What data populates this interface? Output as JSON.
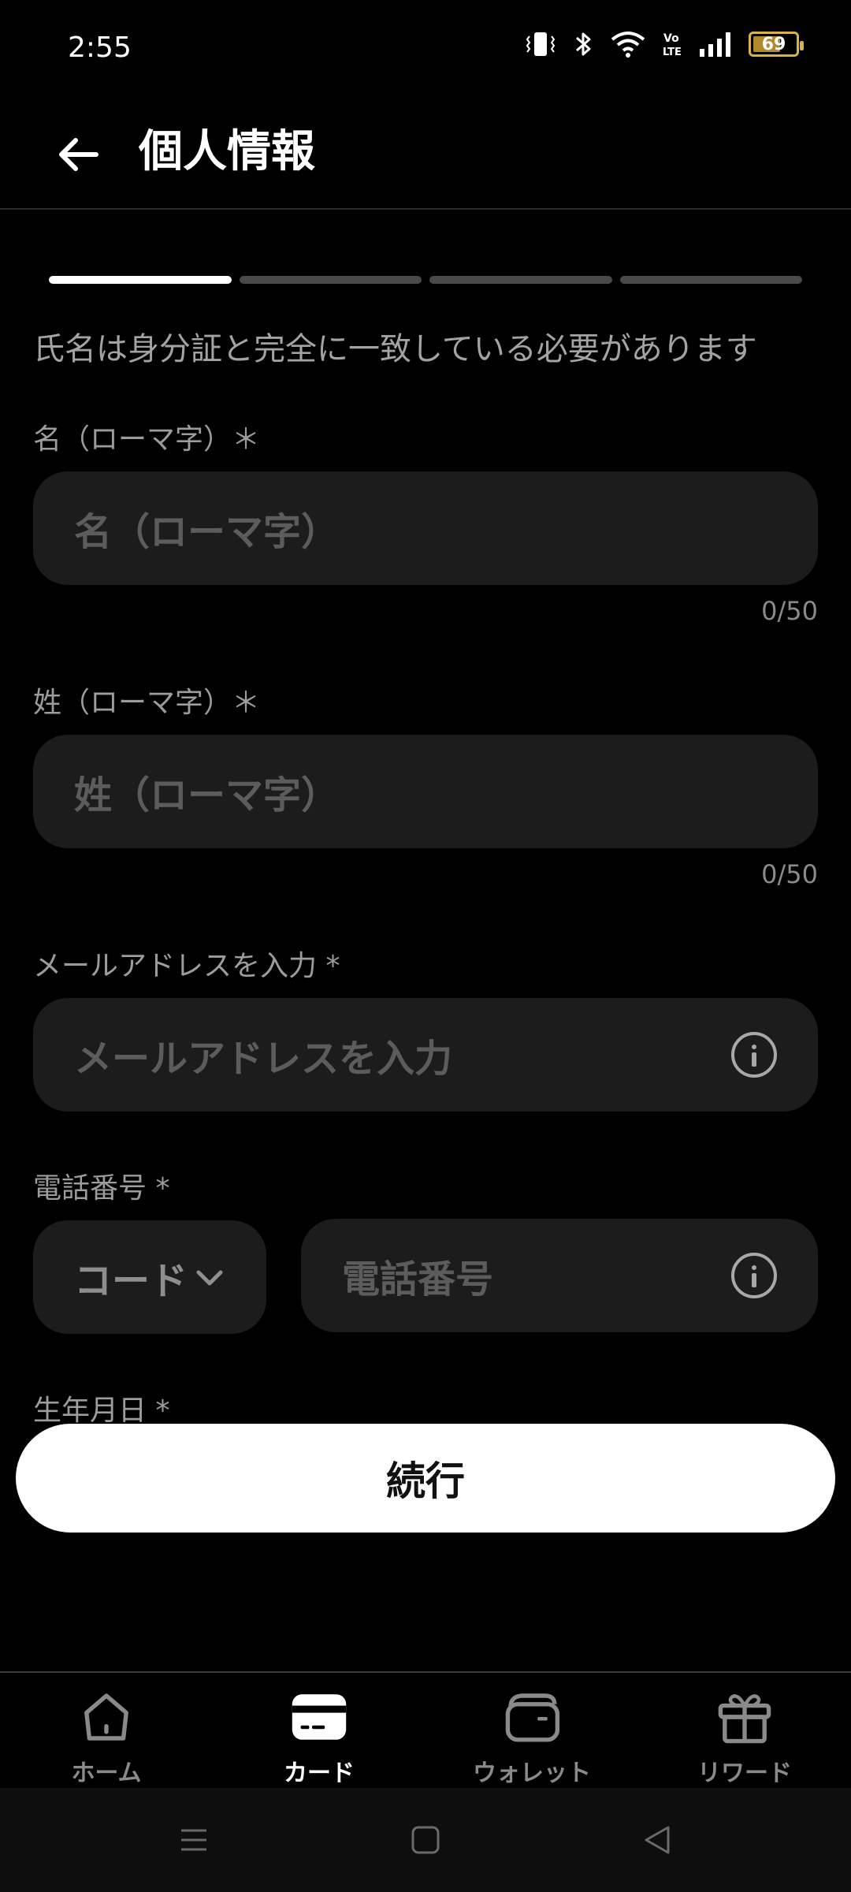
{
  "status_bar": {
    "time": "2:55",
    "battery_level": "69",
    "battery_fraction": 0.69
  },
  "app_bar": {
    "title": "個人情報",
    "back_icon": "arrow-left-icon"
  },
  "progress": {
    "total_steps": 4,
    "current_step": 1
  },
  "notice": "氏名は身分証と完全に一致している必要があります",
  "fields": {
    "first_name": {
      "label": "名（ローマ字）＊",
      "placeholder": "名（ローマ字）",
      "value": "",
      "counter": "0/50"
    },
    "last_name": {
      "label": "姓（ローマ字）＊",
      "placeholder": "姓（ローマ字）",
      "value": "",
      "counter": "0/50"
    },
    "email": {
      "label": "メールアドレスを入力 *",
      "placeholder": "メールアドレスを入力",
      "value": ""
    },
    "phone": {
      "label": "電話番号 *",
      "code_label": "コード",
      "placeholder": "電話番号",
      "value": ""
    },
    "birthdate": {
      "label": "生年月日 *"
    }
  },
  "continue_label": "続行",
  "bottom_nav": {
    "items": [
      {
        "label": "ホーム",
        "icon": "home-icon",
        "active": false
      },
      {
        "label": "カード",
        "icon": "card-icon",
        "active": true
      },
      {
        "label": "ウォレット",
        "icon": "wallet-icon",
        "active": false
      },
      {
        "label": "リワード",
        "icon": "gift-icon",
        "active": false
      }
    ]
  },
  "colors": {
    "background": "#000000",
    "input_bg": "#1c1c1c",
    "placeholder": "#5c5c5c",
    "label": "#9c9c9c",
    "progress_active": "#ffffff",
    "progress_inactive": "#4a4a4a",
    "button_bg": "#ffffff",
    "battery": "#d9b24a"
  }
}
